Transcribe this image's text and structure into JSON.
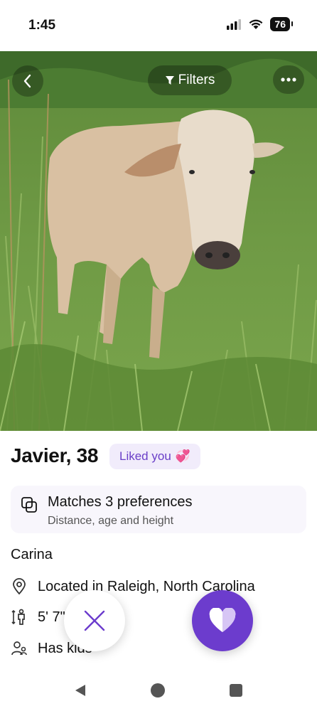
{
  "status_bar": {
    "time": "1:45",
    "battery": "76",
    "icons": [
      "signal-icon",
      "wifi-icon",
      "battery-icon"
    ]
  },
  "photo": {
    "description_icon": "photo"
  },
  "overlay": {
    "filters_label": "Filters"
  },
  "profile": {
    "name_age": "Javier, 38",
    "liked_label": "Liked you",
    "liked_emoji": "💞"
  },
  "match": {
    "title": "Matches 3 preferences",
    "subtitle": "Distance, age and height"
  },
  "about": {
    "label": "Carina",
    "rows": [
      {
        "icon": "location-pin-icon",
        "text": "Located in Raleigh, North Carolina"
      },
      {
        "icon": "height-icon",
        "text": "5' 7\""
      },
      {
        "icon": "kids-icon",
        "text": "Has kids"
      }
    ]
  },
  "colors": {
    "accent": "#6c3ccd",
    "badge_bg": "#f1ecfb",
    "badge_text": "#6a3fc8"
  }
}
